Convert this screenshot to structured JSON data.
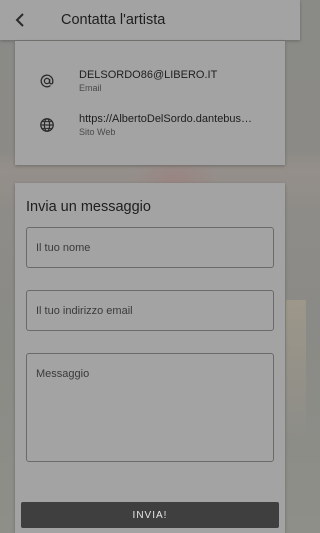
{
  "header": {
    "title": "Contatta l'artista",
    "back_icon": "chevron-left-icon"
  },
  "contact": {
    "email": {
      "icon": "at-icon",
      "value": "DELSORDO86@LIBERO.IT",
      "label": "Email"
    },
    "website": {
      "icon": "globe-icon",
      "value": "https://AlbertoDelSordo.dantebus…",
      "label": "Sito Web"
    }
  },
  "message_form": {
    "title": "Invia un messaggio",
    "name_placeholder": "Il tuo nome",
    "email_placeholder": "Il tuo indirizzo email",
    "message_placeholder": "Messaggio",
    "submit_label": "INVIA!"
  },
  "colors": {
    "overlay_panel": "#a3a3a3",
    "button": "#3f3f3f"
  }
}
